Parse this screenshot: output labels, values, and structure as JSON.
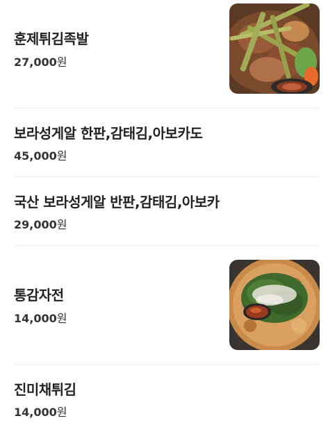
{
  "menu": {
    "items": [
      {
        "name": "훈제튀김족발",
        "price": "27,000",
        "currency": "원",
        "photo": "fried-smoked-jokbal-photo"
      },
      {
        "name": "보라성게알 한판,감태김,아보카도",
        "price": "45,000",
        "currency": "원"
      },
      {
        "name": "국산 보라성게알 반판,감태김,아보카",
        "price": "29,000",
        "currency": "원"
      },
      {
        "name": "통감자전",
        "price": "14,000",
        "currency": "원",
        "photo": "potato-pancake-photo"
      },
      {
        "name": "진미채튀김",
        "price": "14,000",
        "currency": "원"
      }
    ]
  }
}
